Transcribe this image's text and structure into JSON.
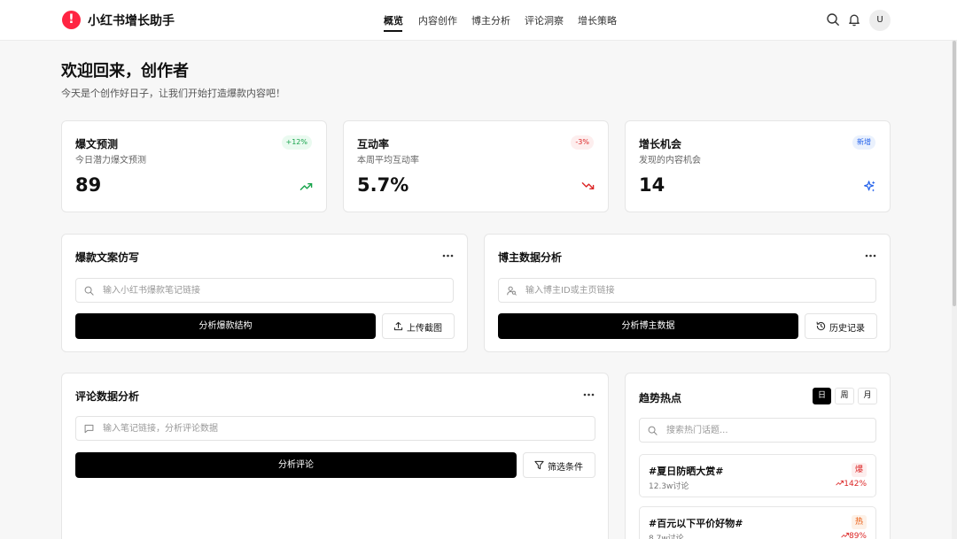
{
  "app": {
    "logo_glyph": "!",
    "title": "小红书增长助手"
  },
  "nav": [
    {
      "label": "概览",
      "active": true
    },
    {
      "label": "内容创作",
      "active": false
    },
    {
      "label": "博主分析",
      "active": false
    },
    {
      "label": "评论洞察",
      "active": false
    },
    {
      "label": "增长策略",
      "active": false
    }
  ],
  "header": {
    "avatar_initial": "U"
  },
  "welcome": {
    "title": "欢迎回来，创作者",
    "subtitle": "今天是个创作好日子，让我们开始打造爆款内容吧！"
  },
  "stats": [
    {
      "title": "爆文预测",
      "desc": "今日潜力爆文预测",
      "value": "89",
      "badge": "+12%",
      "badge_color": "#16a34a",
      "icon": "trending-up-icon"
    },
    {
      "title": "互动率",
      "desc": "本周平均互动率",
      "value": "5.7%",
      "badge": "-3%",
      "badge_color": "#dc2626",
      "icon": "trending-down-icon"
    },
    {
      "title": "增长机会",
      "desc": "发现的内容机会",
      "value": "14",
      "badge": "新增",
      "badge_color": "#2563eb",
      "icon": "sparkles-icon"
    }
  ],
  "copywriting": {
    "title": "爆款文案仿写",
    "placeholder": "输入小红书爆款笔记链接",
    "primary_label": "分析爆款结构",
    "secondary_label": "上传截图"
  },
  "blogger": {
    "title": "博主数据分析",
    "placeholder": "输入博主ID或主页链接",
    "primary_label": "分析博主数据",
    "secondary_label": "历史记录"
  },
  "comments": {
    "title": "评论数据分析",
    "placeholder": "输入笔记链接，分析评论数据",
    "primary_label": "分析评论",
    "secondary_label": "筛选条件"
  },
  "trends": {
    "title": "趋势热点",
    "periods": [
      "日",
      "周",
      "月"
    ],
    "active_period": "日",
    "search_placeholder": "搜索热门话题...",
    "items": [
      {
        "name": "#夏日防晒大赏#",
        "meta": "12.3w讨论",
        "tag": "爆",
        "tag_color": "#dc2626",
        "growth": "142%"
      },
      {
        "name": "#百元以下平价好物#",
        "meta": "8.7w讨论",
        "tag": "热",
        "tag_color": "#ea580c",
        "growth": "89%"
      }
    ]
  },
  "colors": {
    "brand": "#ff2442",
    "up": "#16a34a",
    "down": "#dc2626",
    "accent": "#2563eb"
  }
}
